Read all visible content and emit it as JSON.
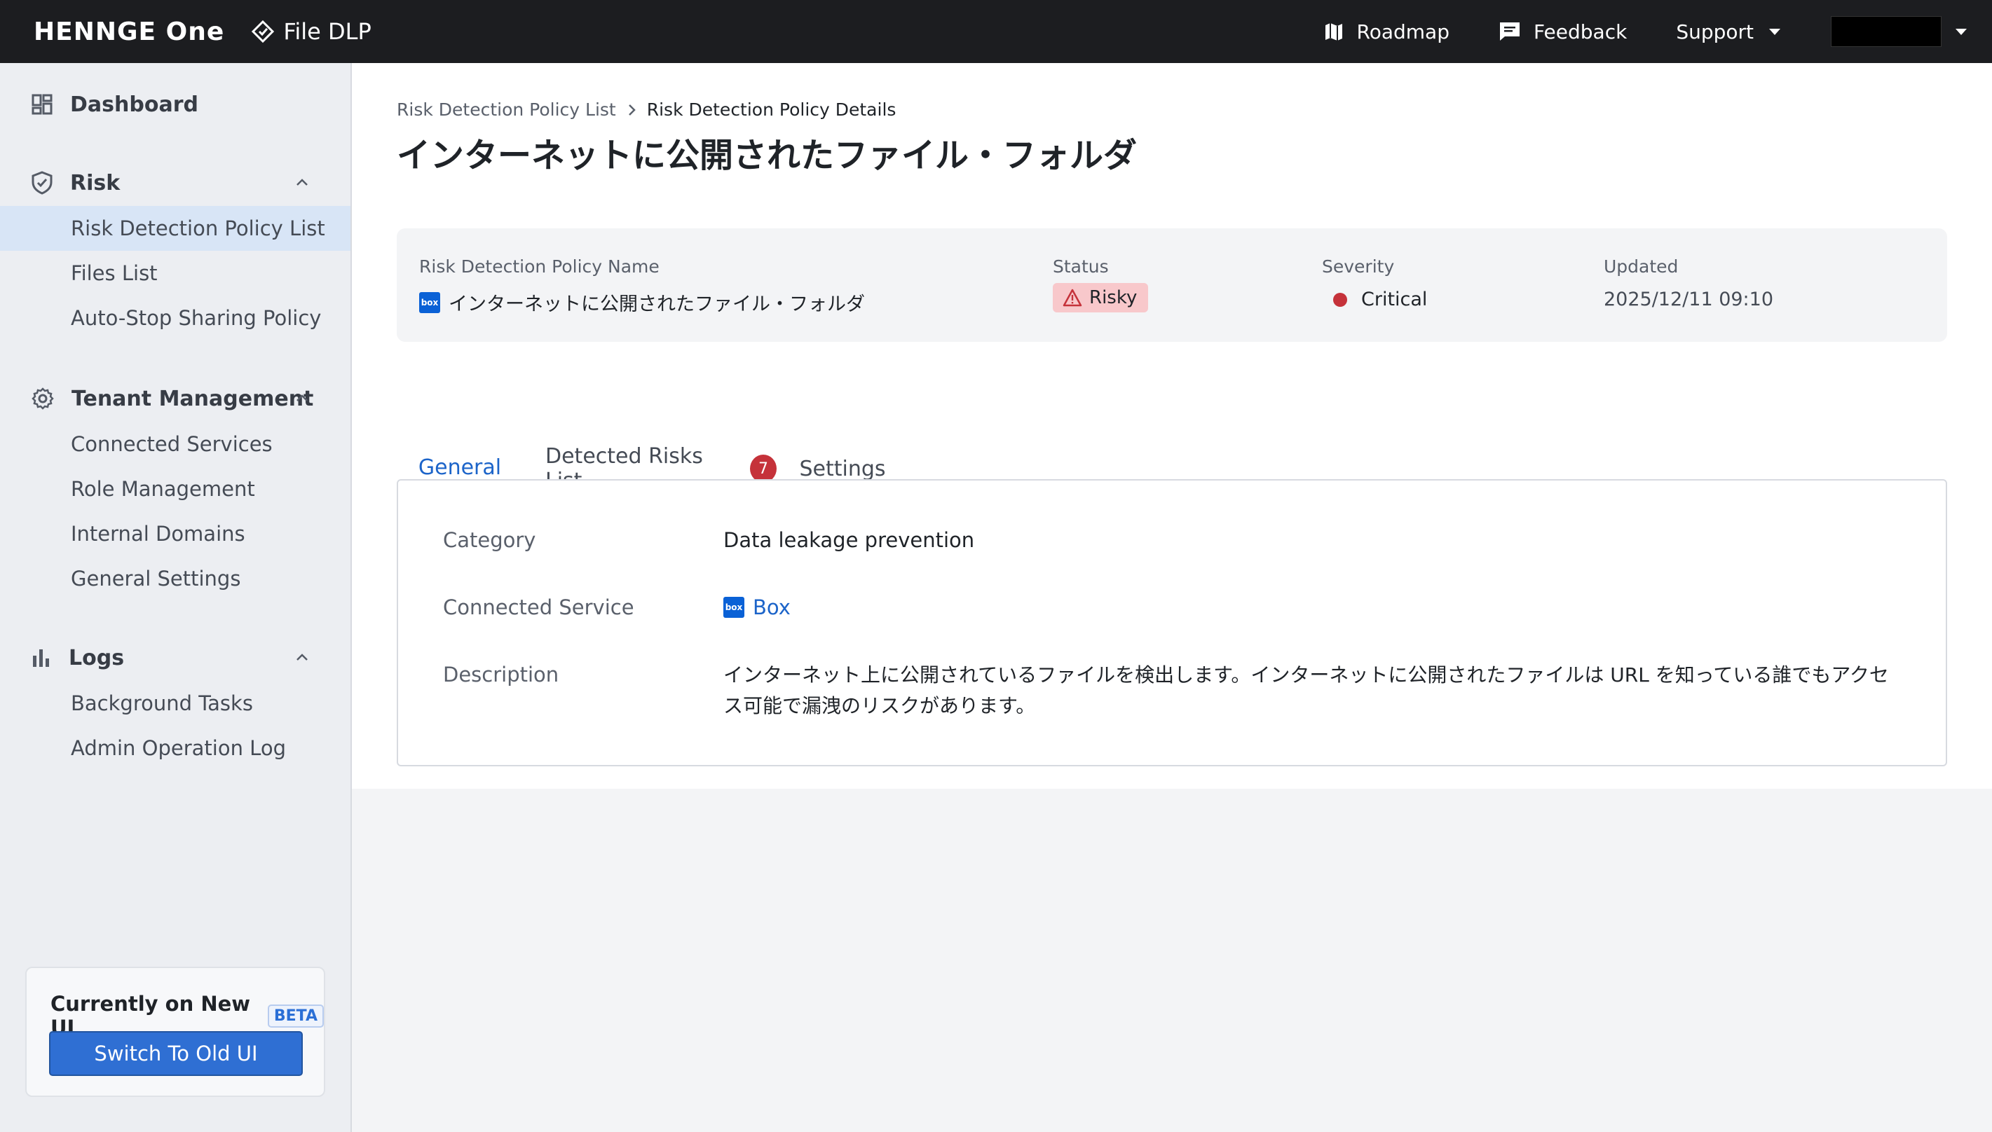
{
  "topbar": {
    "brand": "HENNGE One",
    "product": "File DLP",
    "roadmap": "Roadmap",
    "feedback": "Feedback",
    "support": "Support"
  },
  "sidebar": {
    "dashboard": "Dashboard",
    "risk": {
      "label": "Risk",
      "items": [
        "Risk Detection Policy List",
        "Files List",
        "Auto-Stop Sharing Policy"
      ]
    },
    "tenant": {
      "label": "Tenant Management",
      "items": [
        "Connected Services",
        "Role Management",
        "Internal Domains",
        "General Settings"
      ]
    },
    "logs": {
      "label": "Logs",
      "items": [
        "Background Tasks",
        "Admin Operation Log"
      ]
    },
    "ui_card": {
      "title": "Currently on New UI",
      "beta": "BETA",
      "switch": "Switch To Old UI"
    }
  },
  "breadcrumb": {
    "parent": "Risk Detection Policy List",
    "current": "Risk Detection Policy Details"
  },
  "page_title": "インターネットに公開されたファイル・フォルダ",
  "summary": {
    "name_label": "Risk Detection Policy Name",
    "name_value": "インターネットに公開されたファイル・フォルダ",
    "service_icon": "box",
    "status_label": "Status",
    "status_value": "Risky",
    "severity_label": "Severity",
    "severity_value": "Critical",
    "updated_label": "Updated",
    "updated_value": "2025/12/11 09:10"
  },
  "tabs": {
    "general": "General",
    "detected": "Detected Risks List",
    "detected_count": "7",
    "settings": "Settings"
  },
  "details": {
    "category_label": "Category",
    "category_value": "Data leakage prevention",
    "service_label": "Connected Service",
    "service_value": "Box",
    "description_label": "Description",
    "description_value": "インターネット上に公開されているファイルを検出します。インターネットに公開されたファイルは URL を知っている誰でもアクセス可能で漏洩のリスクがあります。"
  },
  "colors": {
    "accent": "#1c64c9",
    "critical": "#c5323a",
    "risky_bg": "#f8c8cb",
    "topbar": "#1c1d20"
  }
}
